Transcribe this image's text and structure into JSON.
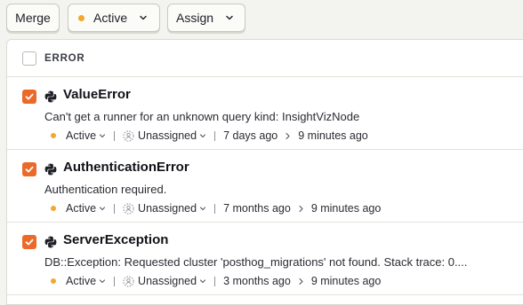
{
  "toolbar": {
    "merge_label": "Merge",
    "status_label": "Active",
    "assign_label": "Assign"
  },
  "header": {
    "column_label": "ERROR"
  },
  "colors": {
    "accent_orange": "#eb6a29",
    "status_active": "#f1a82c"
  },
  "issues": [
    {
      "title": "ValueError",
      "message": "Can't get a runner for an unknown query kind: InsightVizNode",
      "status": "Active",
      "assignee": "Unassigned",
      "first_seen": "7 days ago",
      "last_seen": "9 minutes ago",
      "checked": true,
      "icon": "python-icon"
    },
    {
      "title": "AuthenticationError",
      "message": "Authentication required.",
      "status": "Active",
      "assignee": "Unassigned",
      "first_seen": "7 months ago",
      "last_seen": "9 minutes ago",
      "checked": true,
      "icon": "python-icon"
    },
    {
      "title": "ServerException",
      "message": "DB::Exception: Requested cluster 'posthog_migrations' not found. Stack trace: 0....",
      "status": "Active",
      "assignee": "Unassigned",
      "first_seen": "3 months ago",
      "last_seen": "9 minutes ago",
      "checked": true,
      "icon": "python-icon"
    }
  ]
}
